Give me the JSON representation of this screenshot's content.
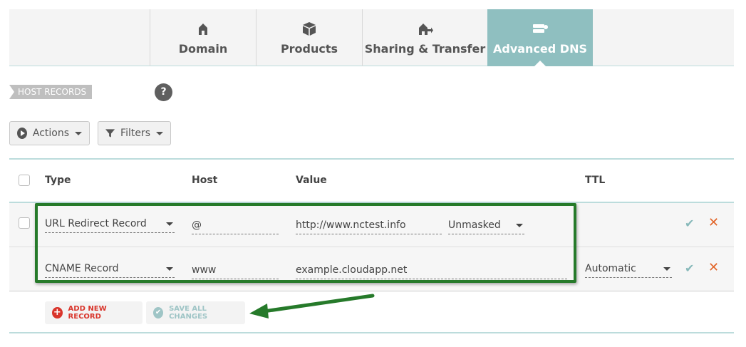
{
  "tabs": [
    {
      "label": "Domain",
      "icon": "home-icon",
      "active": false
    },
    {
      "label": "Products",
      "icon": "box-icon",
      "active": false
    },
    {
      "label": "Sharing & Transfer",
      "icon": "transfer-icon",
      "active": false
    },
    {
      "label": "Advanced DNS",
      "icon": "server-icon",
      "active": true
    }
  ],
  "section": {
    "label": "HOST RECORDS",
    "help": "?"
  },
  "toolbar": {
    "actions_label": "Actions",
    "filters_label": "Filters"
  },
  "table": {
    "headers": {
      "type": "Type",
      "host": "Host",
      "value": "Value",
      "ttl": "TTL"
    },
    "rows": [
      {
        "type": "URL Redirect Record",
        "host": "@",
        "value": "http://www.nctest.info",
        "mask": "Unmasked",
        "ttl": ""
      },
      {
        "type": "CNAME Record",
        "host": "www",
        "value": "example.cloudapp.net",
        "ttl": "Automatic"
      }
    ]
  },
  "footer": {
    "add_label": "ADD NEW RECORD",
    "save_label": "SAVE ALL CHANGES"
  },
  "colors": {
    "accent": "#8fbfc0",
    "highlight": "#267a2a",
    "delete": "#e2662a",
    "add": "#d9352b"
  }
}
